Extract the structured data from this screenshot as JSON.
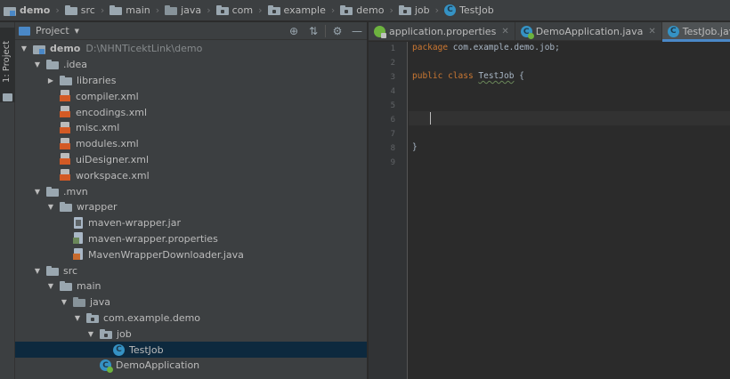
{
  "breadcrumb": [
    {
      "label": "demo",
      "icon": "module-icon"
    },
    {
      "label": "src",
      "icon": "folder-icon"
    },
    {
      "label": "main",
      "icon": "folder-icon"
    },
    {
      "label": "java",
      "icon": "source-folder-icon"
    },
    {
      "label": "com",
      "icon": "package-icon"
    },
    {
      "label": "example",
      "icon": "package-icon"
    },
    {
      "label": "demo",
      "icon": "package-icon"
    },
    {
      "label": "job",
      "icon": "package-icon"
    },
    {
      "label": "TestJob",
      "icon": "class-icon"
    }
  ],
  "tool_stripe": {
    "project_label": "1: Project"
  },
  "project_panel": {
    "title": "Project",
    "tools": {
      "locate": "⊕",
      "collapse": "⇅",
      "settings": "⚙",
      "hide": "—"
    }
  },
  "tree": [
    {
      "depth": 0,
      "arrow": "▼",
      "icon": "module",
      "name": "demo",
      "bold": true,
      "path": "D:\\NHNTicektLink\\demo"
    },
    {
      "depth": 1,
      "arrow": "▼",
      "icon": "folder",
      "name": ".idea"
    },
    {
      "depth": 2,
      "arrow": "▶",
      "icon": "folder",
      "name": "libraries"
    },
    {
      "depth": 2,
      "arrow": "",
      "icon": "xml",
      "name": "compiler.xml"
    },
    {
      "depth": 2,
      "arrow": "",
      "icon": "xml",
      "name": "encodings.xml"
    },
    {
      "depth": 2,
      "arrow": "",
      "icon": "xml",
      "name": "misc.xml"
    },
    {
      "depth": 2,
      "arrow": "",
      "icon": "xml",
      "name": "modules.xml"
    },
    {
      "depth": 2,
      "arrow": "",
      "icon": "xml",
      "name": "uiDesigner.xml"
    },
    {
      "depth": 2,
      "arrow": "",
      "icon": "xml",
      "name": "workspace.xml"
    },
    {
      "depth": 1,
      "arrow": "▼",
      "icon": "folder",
      "name": ".mvn"
    },
    {
      "depth": 2,
      "arrow": "▼",
      "icon": "folder",
      "name": "wrapper"
    },
    {
      "depth": 3,
      "arrow": "",
      "icon": "jar",
      "name": "maven-wrapper.jar"
    },
    {
      "depth": 3,
      "arrow": "",
      "icon": "props",
      "name": "maven-wrapper.properties"
    },
    {
      "depth": 3,
      "arrow": "",
      "icon": "java",
      "name": "MavenWrapperDownloader.java"
    },
    {
      "depth": 1,
      "arrow": "▼",
      "icon": "folder",
      "name": "src"
    },
    {
      "depth": 2,
      "arrow": "▼",
      "icon": "folder",
      "name": "main"
    },
    {
      "depth": 3,
      "arrow": "▼",
      "icon": "srcfolder",
      "name": "java"
    },
    {
      "depth": 4,
      "arrow": "▼",
      "icon": "package",
      "name": "com.example.demo"
    },
    {
      "depth": 5,
      "arrow": "▼",
      "icon": "package",
      "name": "job"
    },
    {
      "depth": 6,
      "arrow": "",
      "icon": "class",
      "name": "TestJob",
      "selected": true
    },
    {
      "depth": 5,
      "arrow": "",
      "icon": "spring",
      "name": "DemoApplication"
    }
  ],
  "editor_tabs": [
    {
      "label": "application.properties",
      "icon": "spring-properties-icon",
      "close": "✕",
      "active": false
    },
    {
      "label": "DemoApplication.java",
      "icon": "spring-class-icon",
      "close": "✕",
      "active": false
    },
    {
      "label": "TestJob.java",
      "icon": "class-icon",
      "close": "✕",
      "active": true
    }
  ],
  "editor": {
    "line_numbers": [
      "1",
      "2",
      "3",
      "4",
      "5",
      "6",
      "7",
      "8",
      "9"
    ],
    "code": {
      "line1_kw": "package",
      "line1_rest": " com.example.demo.job;",
      "line3_kw1": "public",
      "line3_kw2": "class",
      "line3_name": "TestJob",
      "line3_rest": " {",
      "line8": "}"
    },
    "caret_line": 5
  },
  "colors": {
    "accent": "#4a88c7",
    "selection": "#0d293e",
    "keyword": "#cc7832",
    "xml": "#d35a25"
  }
}
